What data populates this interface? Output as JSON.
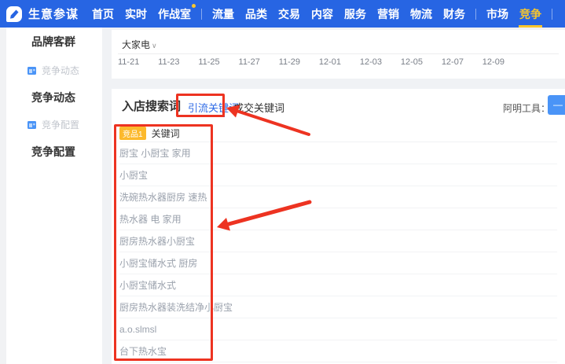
{
  "nav": {
    "brand": "生意参谋",
    "items": [
      "首页",
      "实时",
      "作战室",
      "流量",
      "品类",
      "交易",
      "内容",
      "服务",
      "营销",
      "物流",
      "财务",
      "市场",
      "竞争"
    ],
    "active_item": "竞争"
  },
  "sidebar": {
    "group_brand_audience": "品牌客群",
    "link_competition_trends": "竞争动态",
    "group_competition_trends": "竞争动态",
    "link_competition_config": "竞争配置",
    "group_competition_config": "竞争配置"
  },
  "filter": {
    "category": "大家电",
    "caret": "∨"
  },
  "chart_axis": {
    "dates": [
      "11-21",
      "11-23",
      "11-25",
      "11-27",
      "11-29",
      "12-01",
      "12-03",
      "12-05",
      "12-07",
      "12-09"
    ]
  },
  "search_section": {
    "title": "入店搜索词",
    "tab_traffic_keywords": "引流关键词",
    "tab_deal_keywords": "成交关键词",
    "tools_label": "阿明工具：",
    "tools_button_label": "—"
  },
  "keyword_table": {
    "badge": "竞品1",
    "header": "关键词",
    "rows": [
      "厨宝 小厨宝 家用",
      "小厨宝",
      "洗碗热水器厨房 速热",
      "热水器 电 家用",
      "厨房热水器小厨宝",
      "小厨宝储水式 厨房",
      "小厨宝储水式",
      "厨房热水器装洗结净小厨宝",
      "a.o.slmsl",
      "台下热水宝"
    ]
  },
  "colors": {
    "nav_blue": "#2765e3",
    "accent_yellow": "#f9c62c",
    "badge_yellow": "#fcb92c",
    "tab_blue": "#2f6be6",
    "annotation_red": "#ed3321",
    "content_bg": "#f0f2f5"
  }
}
